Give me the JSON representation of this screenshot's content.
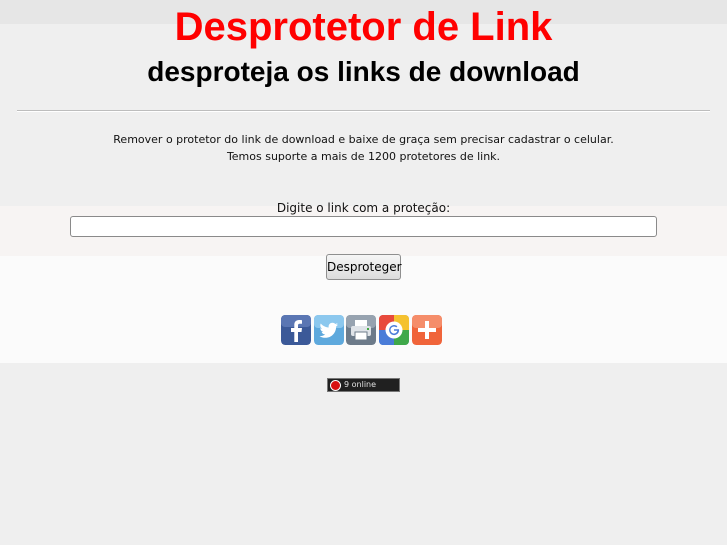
{
  "header": {
    "title": "Desprotetor de Link",
    "subtitle": "desproteja os links de download"
  },
  "description": {
    "line1": "Remover o protetor do link de download e baixe de graça sem precisar cadastrar o celular.",
    "line2": "Temos suporte a mais de 1200 protetores de link."
  },
  "form": {
    "prompt": "Digite o link com a proteção:",
    "input_value": "",
    "input_placeholder": "",
    "button_label": "Desproteger"
  },
  "share": {
    "icons": [
      "facebook-icon",
      "twitter-icon",
      "print-icon",
      "google-icon",
      "add-icon"
    ],
    "colors": {
      "facebook": "#3b5998",
      "twitter": "#5ea9dd",
      "print": "#6d7b8a",
      "google_blue": "#4a7cd8",
      "add": "#f0643a"
    }
  },
  "counter": {
    "text": "9 online"
  },
  "colors": {
    "title": "#ff0000",
    "background": "#efefef"
  }
}
